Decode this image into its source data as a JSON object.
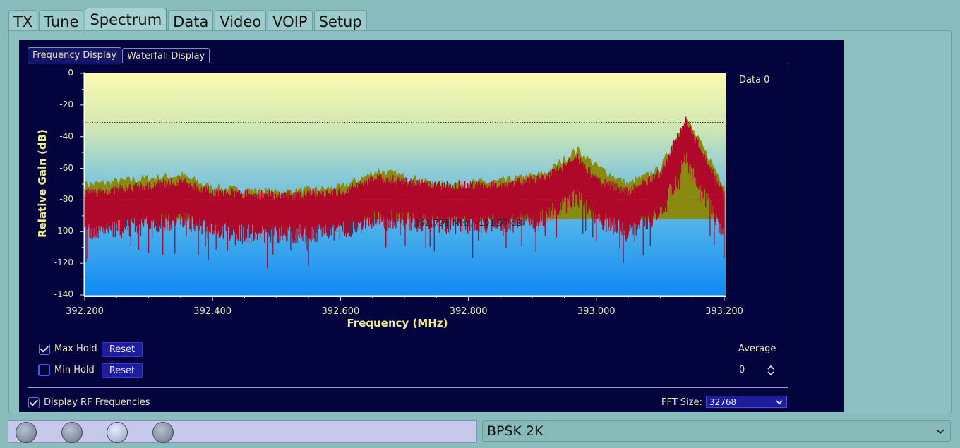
{
  "tabs": [
    "TX",
    "Tune",
    "Spectrum",
    "Data",
    "Video",
    "VOIP",
    "Setup"
  ],
  "active_tab": "Spectrum",
  "sub_tabs": [
    "Frequency Display",
    "Waterfall Display"
  ],
  "chart": {
    "ylabel": "Relative Gain (dB)",
    "xlabel": "Frequency (MHz)",
    "legend": "Data 0",
    "cursor_text": "392.721 MHz, -101.57 dB"
  },
  "chart_data": {
    "type": "line",
    "title": "",
    "xlabel": "Frequency (MHz)",
    "ylabel": "Relative Gain (dB)",
    "xlim": [
      392.2,
      393.2
    ],
    "ylim": [
      -140,
      0
    ],
    "x_ticks": [
      "392.200",
      "392.400",
      "392.600",
      "392.800",
      "393.000",
      "393.200"
    ],
    "y_ticks": [
      "0",
      "-20",
      "-40",
      "-60",
      "-80",
      "-100",
      "-120",
      "-140"
    ],
    "reference_lines_db": [
      -31,
      -80
    ],
    "series": [
      {
        "name": "Data 0",
        "color": "#b0082a",
        "x": [
          392.2,
          392.3,
          392.35,
          392.4,
          392.5,
          392.6,
          392.66,
          392.75,
          392.85,
          392.92,
          392.97,
          393.0,
          393.05,
          393.1,
          393.14,
          393.18,
          393.2
        ],
        "values": [
          -85,
          -80,
          -77,
          -84,
          -86,
          -84,
          -75,
          -80,
          -79,
          -75,
          -62,
          -76,
          -84,
          -72,
          -38,
          -70,
          -85
        ]
      },
      {
        "color": "#8a8a10",
        "x": [
          392.2,
          392.3,
          392.35,
          392.4,
          392.5,
          392.6,
          392.66,
          392.75,
          392.85,
          392.92,
          392.97,
          393.0,
          393.05,
          393.1,
          393.14,
          393.18,
          393.2
        ],
        "values": [
          -72,
          -68,
          -66,
          -74,
          -77,
          -74,
          -63,
          -72,
          -70,
          -65,
          -50,
          -60,
          -72,
          -62,
          -30,
          -58,
          -72
        ]
      }
    ]
  },
  "controls": {
    "max_hold_label": "Max Hold",
    "max_hold_checked": true,
    "min_hold_label": "Min Hold",
    "min_hold_checked": false,
    "reset_label": "Reset",
    "average_label": "Average",
    "average_value": "0",
    "display_rf_label": "Display RF Frequencies",
    "display_rf_checked": true,
    "fft_label": "FFT Size:",
    "fft_value": "32768"
  },
  "bottom": {
    "mode": "BPSK  2K"
  }
}
